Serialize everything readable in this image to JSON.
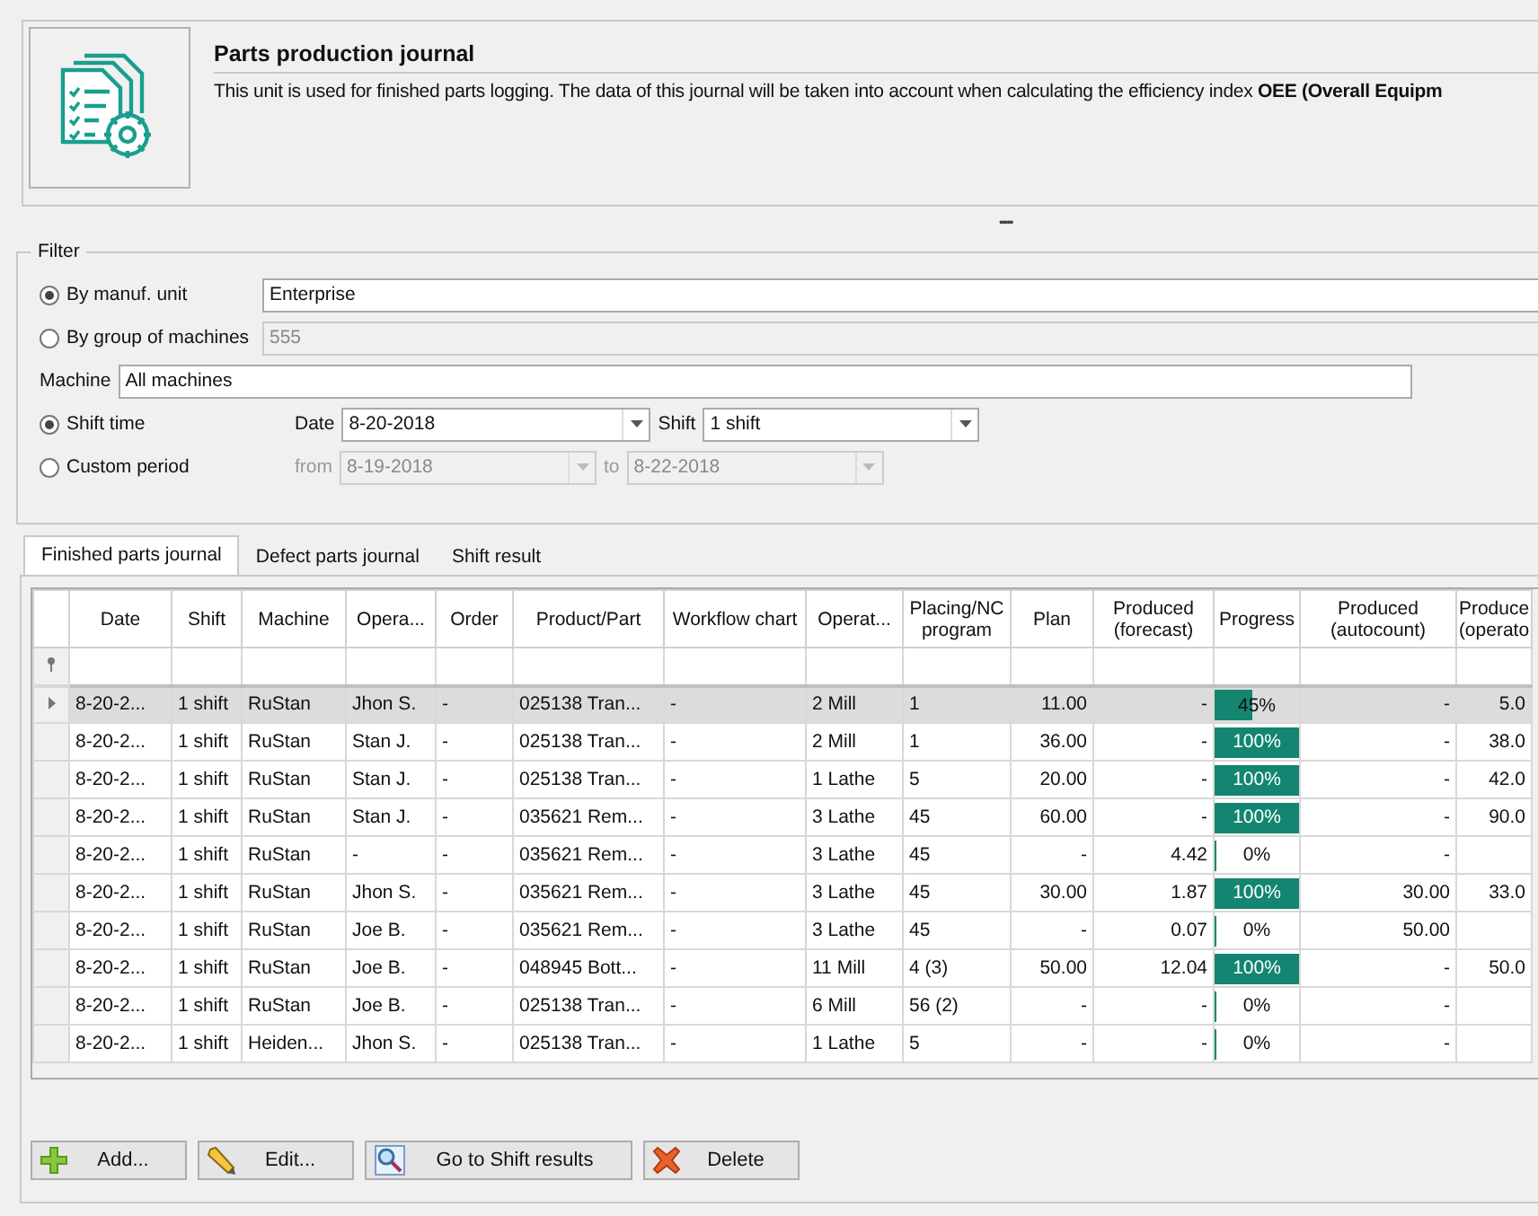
{
  "header": {
    "title": "Parts production journal",
    "description": "This unit is used for finished parts logging. The data of this journal will be taken into account when calculating the efficiency index  **OEE (Overall Equipm**"
  },
  "splitter": "•••••",
  "filter": {
    "title": "Filter",
    "unit_radio": {
      "label": "By manuf. unit",
      "selected": true,
      "value": "Enterprise"
    },
    "group_radio": {
      "label": "By group of machines",
      "selected": false,
      "value": "555"
    },
    "machine": {
      "label": "Machine",
      "value": "All machines"
    },
    "shift_radio": {
      "label": "Shift time",
      "selected": true,
      "date_label": "Date",
      "date": "8-20-2018",
      "shift_label": "Shift",
      "shift": "1 shift"
    },
    "period_radio": {
      "label": "Custom period",
      "selected": false,
      "from_label": "from",
      "from": "8-19-2018",
      "to_label": "to",
      "to": "8-22-2018"
    }
  },
  "tabs": [
    {
      "label": "Finished parts journal",
      "selected": true
    },
    {
      "label": "Defect parts journal",
      "selected": false
    },
    {
      "label": "Shift result",
      "selected": false
    }
  ],
  "table": {
    "columns": [
      {
        "label": "Date",
        "kind": "text"
      },
      {
        "label": "Shift",
        "kind": "text"
      },
      {
        "label": "Machine",
        "kind": "text"
      },
      {
        "label": "Opera...",
        "kind": "text"
      },
      {
        "label": "Order",
        "kind": "text"
      },
      {
        "label": "Product/Part",
        "kind": "text"
      },
      {
        "label": "Workflow chart",
        "kind": "text"
      },
      {
        "label": "Operat...",
        "kind": "text"
      },
      {
        "label": "Placing/NC program",
        "kind": "text"
      },
      {
        "label": "Plan",
        "kind": "number"
      },
      {
        "label": "Produced (forecast)",
        "kind": "number"
      },
      {
        "label": "Progress",
        "kind": "progress"
      },
      {
        "label": "Produced (autocount)",
        "kind": "number"
      },
      {
        "label": "Produce (operato",
        "kind": "number"
      }
    ],
    "rows": [
      {
        "selected": true,
        "level": 0.45,
        "cells": [
          "8-20-2...",
          "1 shift",
          "RuStan",
          "Jhon S.",
          "-",
          "025138 Tran...",
          "-",
          "2 Mill",
          "1",
          "11.00",
          "-",
          "45%",
          "-",
          "5.0"
        ]
      },
      {
        "selected": false,
        "level": 1,
        "cells": [
          "8-20-2...",
          "1 shift",
          "RuStan",
          "Stan J.",
          "-",
          "025138 Tran...",
          "-",
          "2 Mill",
          "1",
          "36.00",
          "-",
          "100%",
          "-",
          "38.0"
        ]
      },
      {
        "selected": false,
        "level": 1,
        "cells": [
          "8-20-2...",
          "1 shift",
          "RuStan",
          "Stan J.",
          "-",
          "025138 Tran...",
          "-",
          "1 Lathe",
          "5",
          "20.00",
          "-",
          "100%",
          "-",
          "42.0"
        ]
      },
      {
        "selected": false,
        "level": 1,
        "cells": [
          "8-20-2...",
          "1 shift",
          "RuStan",
          "Stan J.",
          "-",
          "035621 Rem...",
          "-",
          "3 Lathe",
          "45",
          "60.00",
          "-",
          "100%",
          "-",
          "90.0"
        ]
      },
      {
        "selected": false,
        "level": 0,
        "cells": [
          "8-20-2...",
          "1 shift",
          "RuStan",
          "-",
          "-",
          "035621 Rem...",
          "-",
          "3 Lathe",
          "45",
          "-",
          "4.42",
          "0%",
          "-",
          null
        ]
      },
      {
        "selected": false,
        "level": 1,
        "cells": [
          "8-20-2...",
          "1 shift",
          "RuStan",
          "Jhon S.",
          "-",
          "035621 Rem...",
          "-",
          "3 Lathe",
          "45",
          "30.00",
          "1.87",
          "100%",
          "30.00",
          "33.0"
        ]
      },
      {
        "selected": false,
        "level": 0,
        "cells": [
          "8-20-2...",
          "1 shift",
          "RuStan",
          "Joe B.",
          "-",
          "035621 Rem...",
          "-",
          "3 Lathe",
          "45",
          "-",
          "0.07",
          "0%",
          "50.00",
          null
        ]
      },
      {
        "selected": false,
        "level": 1,
        "cells": [
          "8-20-2...",
          "1 shift",
          "RuStan",
          "Joe B.",
          "-",
          "048945 Bott...",
          "-",
          "11 Mill",
          "4 (3)",
          "50.00",
          "12.04",
          "100%",
          "-",
          "50.0"
        ]
      },
      {
        "selected": false,
        "level": 0,
        "cells": [
          "8-20-2...",
          "1 shift",
          "RuStan",
          "Joe B.",
          "-",
          "025138 Tran...",
          "-",
          "6 Mill",
          "56 (2)",
          "-",
          "-",
          "0%",
          "-",
          null
        ]
      },
      {
        "selected": false,
        "level": 0,
        "cells": [
          "8-20-2...",
          "1 shift",
          "Heiden...",
          "Jhon S.",
          "-",
          "025138 Tran...",
          "-",
          "1 Lathe",
          "5",
          "-",
          "-",
          "0%",
          "-",
          null
        ]
      }
    ]
  },
  "buttons": [
    {
      "label": "Add...",
      "kind": "add"
    },
    {
      "label": "Edit...",
      "kind": "edit"
    },
    {
      "label": "Go to Shift results",
      "kind": "search"
    },
    {
      "label": "Delete",
      "kind": "delete"
    }
  ]
}
